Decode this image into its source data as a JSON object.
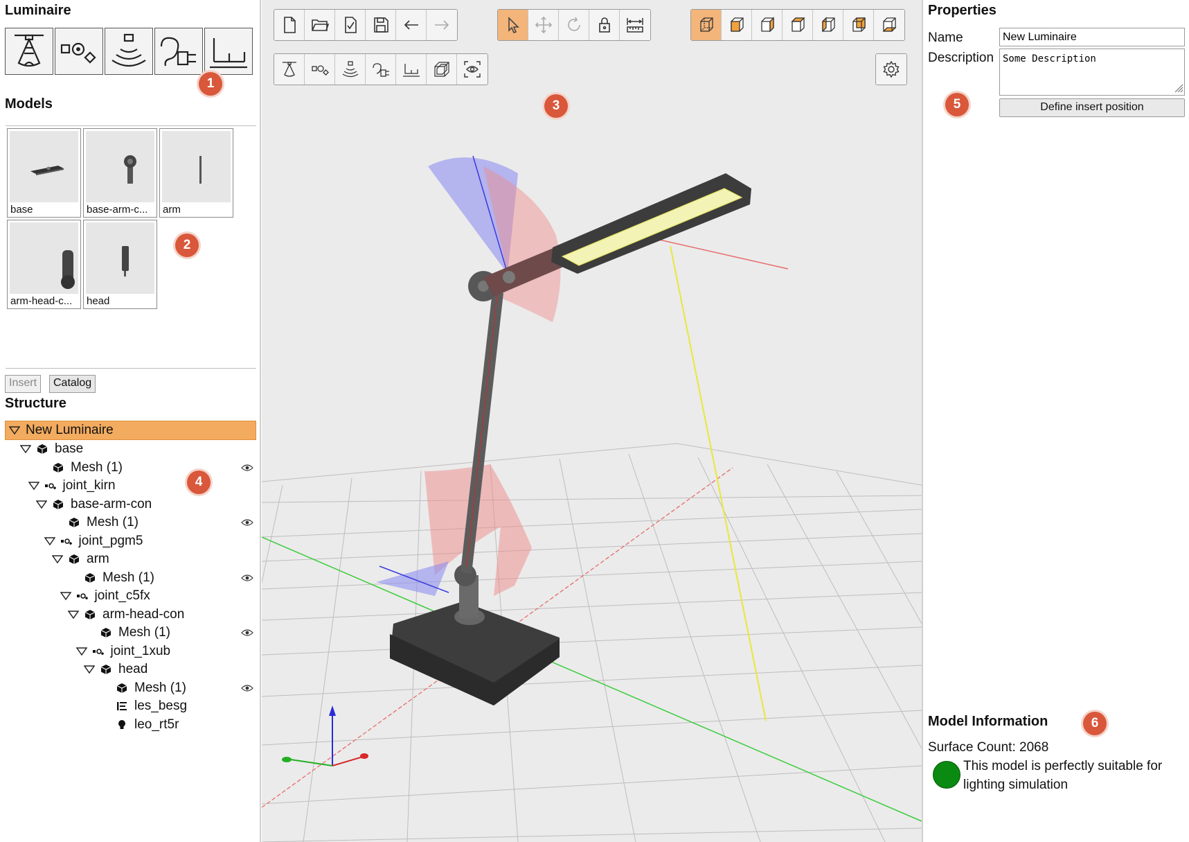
{
  "left_panel": {
    "luminaire_title": "Luminaire",
    "models_title": "Models",
    "structure_title": "Structure",
    "tabs": {
      "insert": "Insert",
      "catalog": "Catalog"
    },
    "category_buttons": [
      "luminaire-head-icon",
      "joint-icon",
      "emitter-icon",
      "plug-icon",
      "base-icon"
    ],
    "models": [
      {
        "label": "base"
      },
      {
        "label": "base-arm-c..."
      },
      {
        "label": "arm"
      },
      {
        "label": "arm-head-c..."
      },
      {
        "label": "head"
      }
    ],
    "tree": {
      "root": "New Luminaire",
      "items": [
        {
          "label": "base",
          "type": "mesh-group",
          "level": 1,
          "expander": true,
          "eye": false
        },
        {
          "label": "Mesh (1)",
          "type": "mesh",
          "level": 2,
          "expander": false,
          "eye": true
        },
        {
          "label": "joint_kirn",
          "type": "joint",
          "level": 1.5,
          "expander": true,
          "eye": false
        },
        {
          "label": "base-arm-con",
          "type": "mesh-group",
          "level": 2,
          "expander": true,
          "eye": false
        },
        {
          "label": "Mesh (1)",
          "type": "mesh",
          "level": 3,
          "expander": false,
          "eye": true
        },
        {
          "label": "joint_pgm5",
          "type": "joint",
          "level": 2.5,
          "expander": true,
          "eye": false
        },
        {
          "label": "arm",
          "type": "mesh-group",
          "level": 3,
          "expander": true,
          "eye": false
        },
        {
          "label": "Mesh (1)",
          "type": "mesh",
          "level": 4,
          "expander": false,
          "eye": true
        },
        {
          "label": "joint_c5fx",
          "type": "joint",
          "level": 3.5,
          "expander": true,
          "eye": false
        },
        {
          "label": "arm-head-con",
          "type": "mesh-group",
          "level": 4,
          "expander": true,
          "eye": false
        },
        {
          "label": "Mesh (1)",
          "type": "mesh",
          "level": 5,
          "expander": false,
          "eye": true
        },
        {
          "label": "joint_1xub",
          "type": "joint",
          "level": 4.5,
          "expander": true,
          "eye": false
        },
        {
          "label": "head",
          "type": "mesh-group",
          "level": 5,
          "expander": true,
          "eye": false
        },
        {
          "label": "Mesh (1)",
          "type": "mesh",
          "level": 6,
          "expander": false,
          "eye": true
        },
        {
          "label": "les_besg",
          "type": "les",
          "level": 6,
          "expander": false,
          "eye": false
        },
        {
          "label": "leo_rt5r",
          "type": "light",
          "level": 6,
          "expander": false,
          "eye": false
        }
      ]
    }
  },
  "toolbar": {
    "file_group": [
      "new-file-icon",
      "open-folder-icon",
      "check-file-icon",
      "save-icon",
      "undo-arrow-icon",
      "redo-arrow-icon"
    ],
    "tool_group": [
      "select-pointer-icon",
      "move-icon",
      "rotate-icon",
      "lock-icon",
      "measure-icon"
    ],
    "view_group": [
      "perspective-cube-icon",
      "front-cube-icon",
      "right-cube-icon",
      "top-cube-icon",
      "left-cube-icon",
      "back-cube-icon",
      "bottom-cube-icon"
    ],
    "insert_group": [
      "luminaire-head-icon",
      "joint-icon",
      "emitter-icon",
      "plug-icon",
      "base-icon",
      "wireframe-icon",
      "focus-eye-icon"
    ],
    "settings": "gear-icon"
  },
  "properties": {
    "title": "Properties",
    "name_label": "Name",
    "name_value": "New Luminaire",
    "description_label": "Description",
    "description_value": "Some Description",
    "define_button": "Define insert position"
  },
  "model_info": {
    "title": "Model Information",
    "surface_count": "Surface Count: 2068",
    "status_line1": "This model is perfectly suitable for",
    "status_line2": "lighting simulation",
    "status_color": "#0a8a10"
  },
  "badges": [
    "1",
    "2",
    "3",
    "4",
    "5",
    "6"
  ],
  "colors": {
    "accent": "#f4b57a",
    "badge": "#d9573a",
    "selection": "#f3ab5f"
  }
}
